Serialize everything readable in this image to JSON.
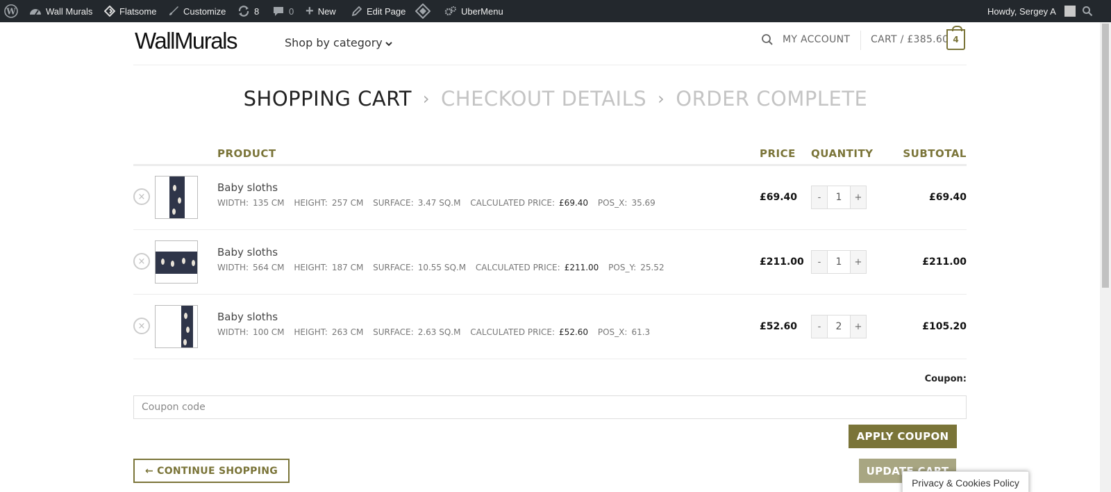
{
  "adminbar": {
    "site_name": "Wall Murals",
    "theme": "Flatsome",
    "customize": "Customize",
    "updates": "8",
    "comments": "0",
    "new": "New",
    "edit_page": "Edit Page",
    "ubermenu": "UberMenu",
    "howdy": "Howdy, Sergey A"
  },
  "header": {
    "logo": "WallMurals",
    "shop_by_category": "Shop by category",
    "my_account": "MY ACCOUNT",
    "cart": "CART / £385.60",
    "cart_count": "4"
  },
  "steps": {
    "cart": "SHOPPING CART",
    "checkout": "CHECKOUT DETAILS",
    "complete": "ORDER COMPLETE",
    "separator": "›"
  },
  "table": {
    "headers": {
      "product": "PRODUCT",
      "price": "PRICE",
      "quantity": "QUANTITY",
      "subtotal": "SUBTOTAL"
    },
    "rows": [
      {
        "name": "Baby sloths",
        "width_label": "WIDTH:",
        "width": "135 CM",
        "height_label": "HEIGHT:",
        "height": "257 CM",
        "surface_label": "SURFACE:",
        "surface": "3.47 SQ.M",
        "calc_label": "CALCULATED PRICE:",
        "calc": "£69.40",
        "pos_label": "POS_X:",
        "pos": "35.69",
        "price": "£69.40",
        "qty": "1",
        "subtotal": "£69.40"
      },
      {
        "name": "Baby sloths",
        "width_label": "WIDTH:",
        "width": "564 CM",
        "height_label": "HEIGHT:",
        "height": "187 CM",
        "surface_label": "SURFACE:",
        "surface": "10.55 SQ.M",
        "calc_label": "CALCULATED PRICE:",
        "calc": "£211.00",
        "pos_label": "POS_Y:",
        "pos": "25.52",
        "price": "£211.00",
        "qty": "1",
        "subtotal": "£211.00"
      },
      {
        "name": "Baby sloths",
        "width_label": "WIDTH:",
        "width": "100 CM",
        "height_label": "HEIGHT:",
        "height": "263 CM",
        "surface_label": "SURFACE:",
        "surface": "2.63 SQ.M",
        "calc_label": "CALCULATED PRICE:",
        "calc": "£52.60",
        "pos_label": "POS_X:",
        "pos": "61.3",
        "price": "£52.60",
        "qty": "2",
        "subtotal": "£105.20"
      }
    ],
    "minus": "-",
    "plus": "+",
    "remove": "×"
  },
  "coupon": {
    "label": "Coupon:",
    "placeholder": "Coupon code",
    "apply": "APPLY COUPON"
  },
  "actions": {
    "continue": "← CONTINUE SHOPPING",
    "update": "UPDATE CART"
  },
  "privacy": "Privacy & Cookies Policy",
  "colors": {
    "accent": "#7a7438",
    "adminbar": "#23282d"
  }
}
